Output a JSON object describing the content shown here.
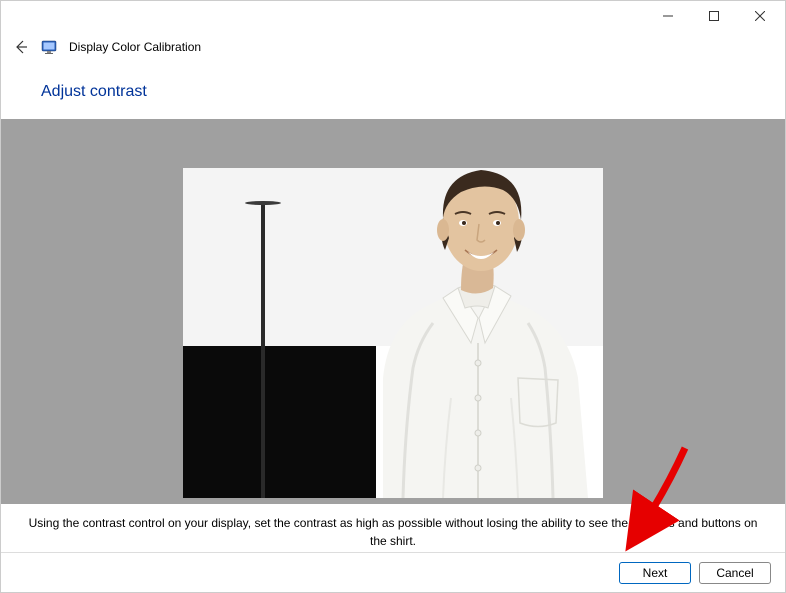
{
  "window": {
    "app_title": "Display Color Calibration"
  },
  "page": {
    "heading": "Adjust contrast",
    "instruction": "Using the contrast control on your display, set the contrast as high as possible without losing the ability to see the wrinkles and buttons on the shirt."
  },
  "buttons": {
    "next": "Next",
    "cancel": "Cancel"
  }
}
